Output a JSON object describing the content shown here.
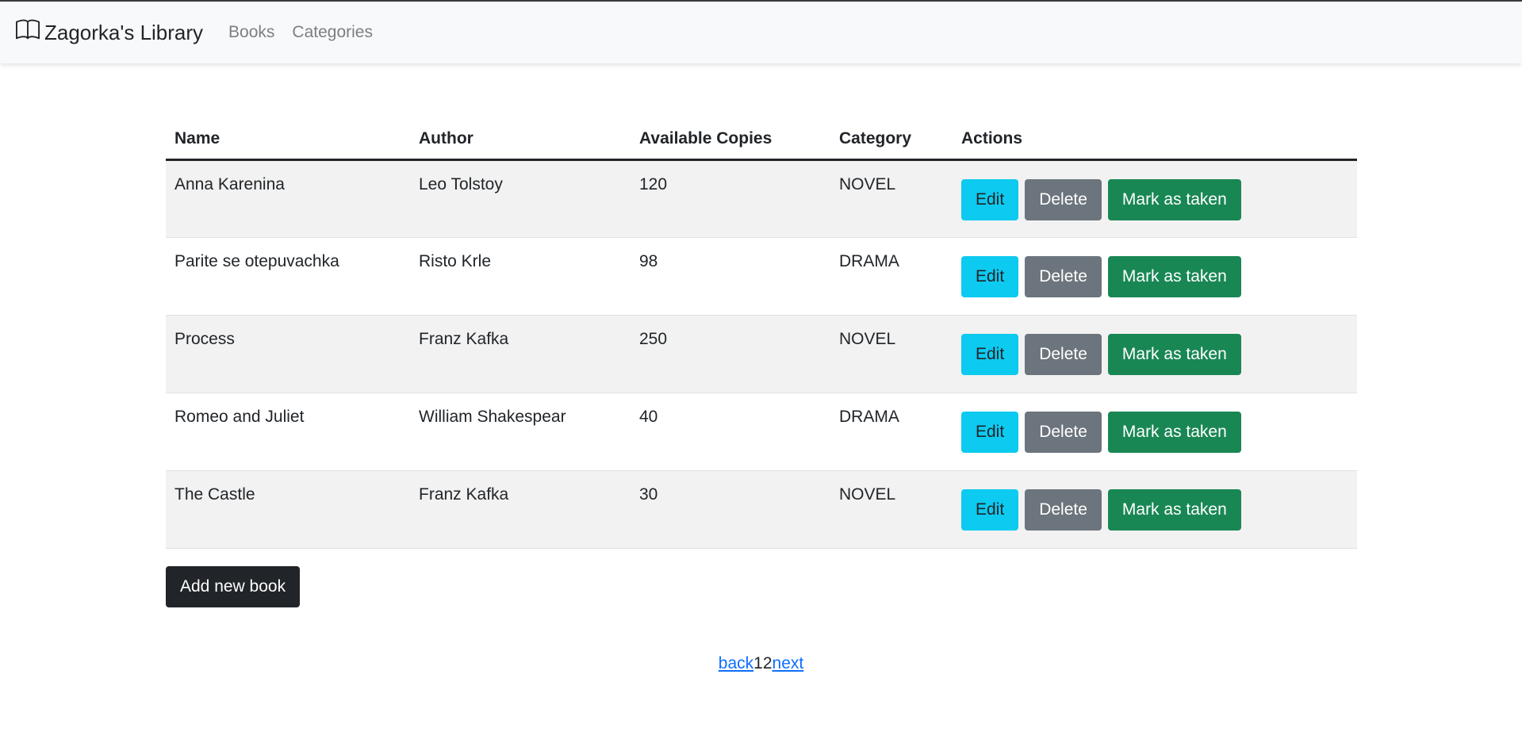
{
  "navbar": {
    "brand": "Zagorka's Library",
    "links": [
      "Books",
      "Categories"
    ]
  },
  "table": {
    "headers": [
      "Name",
      "Author",
      "Available Copies",
      "Category",
      "Actions"
    ],
    "rows": [
      {
        "name": "Anna Karenina",
        "author": "Leo Tolstoy",
        "copies": "120",
        "category": "NOVEL"
      },
      {
        "name": "Parite se otepuvachka",
        "author": "Risto Krle",
        "copies": "98",
        "category": "DRAMA"
      },
      {
        "name": "Process",
        "author": "Franz Kafka",
        "copies": "250",
        "category": "NOVEL"
      },
      {
        "name": "Romeo and Juliet",
        "author": "William Shakespear",
        "copies": "40",
        "category": "DRAMA"
      },
      {
        "name": "The Castle",
        "author": "Franz Kafka",
        "copies": "30",
        "category": "NOVEL"
      }
    ],
    "actions": {
      "edit": "Edit",
      "delete": "Delete",
      "taken": "Mark as taken"
    }
  },
  "add_button": "Add new book",
  "pagination": {
    "back": "back",
    "pages": [
      "1",
      "2"
    ],
    "next": "next"
  },
  "colors": {
    "edit": "#0dcaf0",
    "delete": "#6c757d",
    "taken": "#198754",
    "add": "#212529",
    "link": "#0d6efd"
  }
}
